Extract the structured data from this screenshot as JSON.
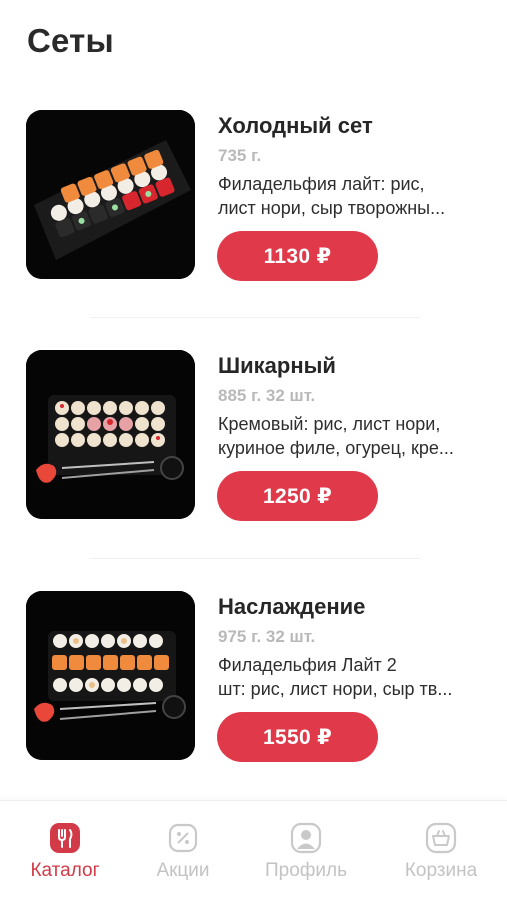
{
  "header": {
    "title": "Сеты"
  },
  "products": [
    {
      "name": "Холодный сет",
      "weight": "735 г.",
      "description_line1": "Филадельфия лайт: рис,",
      "description_line2": "лист нори, сыр творожны...",
      "price": "1130 ₽",
      "image_icon": "sushi-set-photo"
    },
    {
      "name": "Шикарный",
      "weight": "885 г. 32 шт.",
      "description_line1": "Кремовый: рис, лист нори,",
      "description_line2": "куриное филе, огурец, кре...",
      "price": "1250 ₽",
      "image_icon": "sushi-set-photo"
    },
    {
      "name": "Наслаждение",
      "weight": "975 г. 32 шт.",
      "description_line1": "Филадельфия Лайт 2",
      "description_line2": "шт: рис, лист нори, сыр тв...",
      "price": "1550 ₽",
      "image_icon": "sushi-set-photo"
    }
  ],
  "bottom_nav": {
    "items": [
      {
        "label": "Каталог",
        "icon": "utensils-icon",
        "active": true
      },
      {
        "label": "Акции",
        "icon": "percent-tag-icon",
        "active": false
      },
      {
        "label": "Профиль",
        "icon": "user-icon",
        "active": false
      },
      {
        "label": "Корзина",
        "icon": "basket-icon",
        "active": false
      }
    ]
  },
  "colors": {
    "accent": "#e0394a",
    "active_nav": "#d23a47",
    "inactive_nav": "#c3c3c3",
    "weight_text": "#b9b9b9"
  }
}
